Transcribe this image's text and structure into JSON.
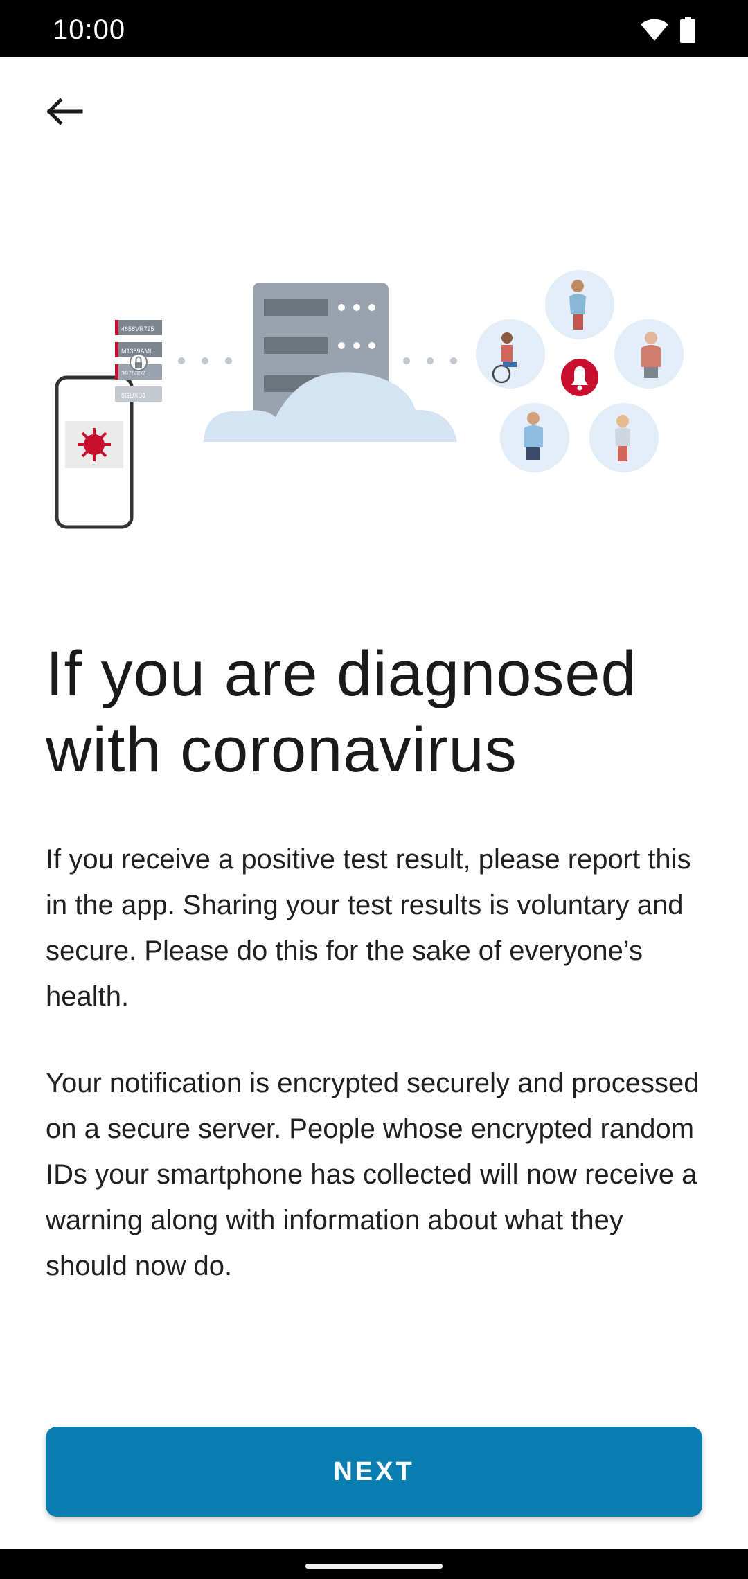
{
  "status_bar": {
    "time": "10:00",
    "icons": [
      "wifi-icon",
      "battery-icon"
    ]
  },
  "header": {
    "back_icon": "arrow-left-icon"
  },
  "illustration": {
    "id_list": [
      "4658VR725",
      "M1389AML",
      "3975302",
      "8GUXS1"
    ]
  },
  "content": {
    "title": "If you are diagnosed with coronavirus",
    "paragraph_1": "If you receive a positive test result, please report this in the app. Sharing your test results is voluntary and secure. Please do this for the sake of everyone’s health.",
    "paragraph_2": "Your notification is encrypted securely and processed on a secure server. People whose encrypted random IDs your smartphone has collected will now receive a warning along with information about what they should now do."
  },
  "actions": {
    "next_label": "NEXT"
  },
  "colors": {
    "accent": "#0a7eb0",
    "alert_red": "#c8102e",
    "server_gray": "#9aa3ad",
    "cloud_blue": "#d4e4f2"
  }
}
